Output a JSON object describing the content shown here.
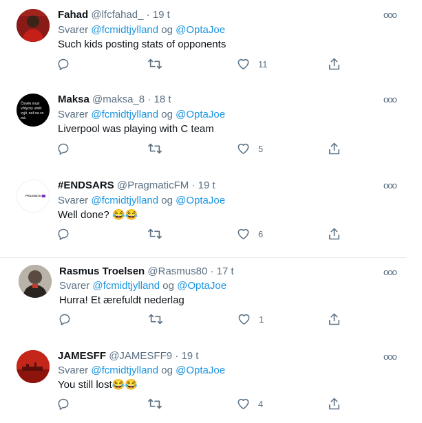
{
  "labels": {
    "replying_prefix": "Svarer",
    "joiner": "og"
  },
  "tweets": [
    {
      "name": "Fahad",
      "handle": "@lfcfahad_",
      "time": "19 t",
      "mention1": "@fcmidtjylland",
      "mention2": "@OptaJoe",
      "text": "Such kids posting stats of opponents",
      "likes": "11",
      "avatar_caption": ""
    },
    {
      "name": "Maksa",
      "handle": "@maksa_8",
      "time": "18 t",
      "mention1": "@fcmidtjylland",
      "mention2": "@OptaJoe",
      "text": "Liverpool was playing with C team",
      "likes": "5",
      "avatar_caption": "Člověk musí vždycky umět vyjít, než na co má."
    },
    {
      "name": "#ENDSARS",
      "handle": "@PragmaticFM",
      "time": "19 t",
      "mention1": "@fcmidtjylland",
      "mention2": "@OptaJoe",
      "text": "Well done? 😂😂",
      "likes": "6",
      "avatar_caption": "PRAGMATIC"
    },
    {
      "name": "Rasmus Troelsen",
      "handle": "@Rasmus80",
      "time": "17 t",
      "mention1": "@fcmidtjylland",
      "mention2": "@OptaJoe",
      "text": "Hurra! Et ærefuldt nederlag",
      "likes": "1",
      "avatar_caption": ""
    },
    {
      "name": "JAMESFF",
      "handle": "@JAMESFF9",
      "time": "19 t",
      "mention1": "@fcmidtjylland",
      "mention2": "@OptaJoe",
      "text": "You still lost😂😂",
      "likes": "4",
      "avatar_caption": ""
    }
  ],
  "icons": {
    "reply": "reply-icon",
    "retweet": "retweet-icon",
    "like": "heart-icon",
    "share": "share-icon",
    "more": "more-options-icon"
  },
  "colors": {
    "mention": "#1b95e0",
    "secondary": "#5b7083",
    "divider": "#e6ecf0"
  }
}
